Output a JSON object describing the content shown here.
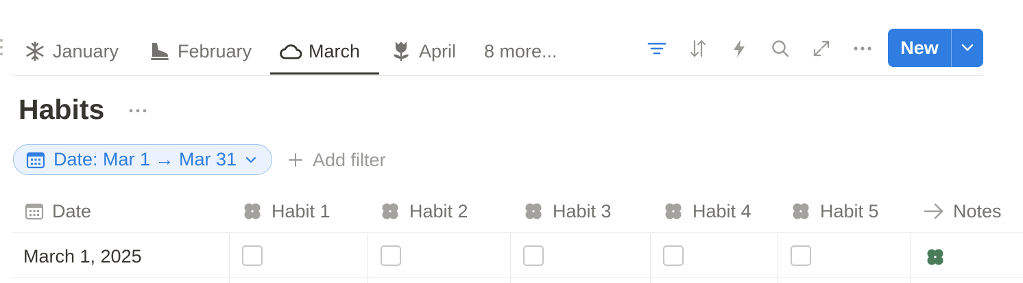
{
  "tabs": [
    {
      "label": "January",
      "icon": "snowflake-icon"
    },
    {
      "label": "February",
      "icon": "ice-skate-icon"
    },
    {
      "label": "March",
      "icon": "cloud-icon",
      "active": true
    },
    {
      "label": "April",
      "icon": "tulip-icon"
    }
  ],
  "tabs_more": "8 more...",
  "toolbar": {
    "icons": [
      "filter-icon",
      "sort-icon",
      "lightning-icon",
      "search-icon",
      "expand-icon",
      "more-icon"
    ],
    "new_label": "New",
    "accent": "#2f7de1"
  },
  "database": {
    "title": "Habits"
  },
  "filter": {
    "chip_label": "Date: Mar 1 → Mar 31",
    "add_label": "Add filter"
  },
  "table": {
    "columns": [
      {
        "label": "Date",
        "icon": "calendar-icon"
      },
      {
        "label": "Habit 1",
        "icon": "clover-icon"
      },
      {
        "label": "Habit 2",
        "icon": "clover-icon"
      },
      {
        "label": "Habit 3",
        "icon": "clover-icon"
      },
      {
        "label": "Habit 4",
        "icon": "clover-icon"
      },
      {
        "label": "Habit 5",
        "icon": "clover-icon"
      },
      {
        "label": "Notes",
        "icon": "arrow-right-icon"
      }
    ],
    "rows": [
      {
        "date": "March 1, 2025",
        "habits": [
          false,
          false,
          false,
          false,
          false
        ],
        "notes_icon": "clover-icon"
      }
    ]
  },
  "colors": {
    "text": "#37352f",
    "muted": "#73726e",
    "clover_green": "#4a7c59",
    "clover_gray": "#a3a29f"
  }
}
